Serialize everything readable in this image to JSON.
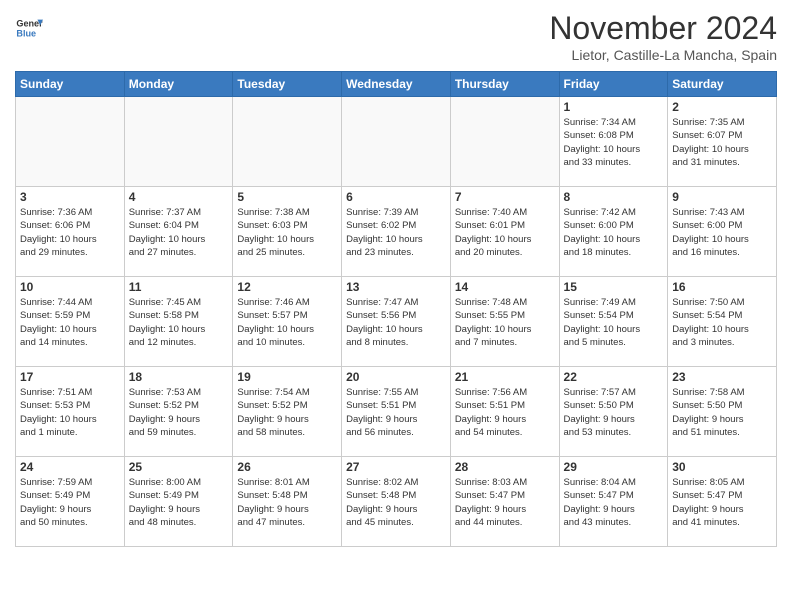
{
  "header": {
    "logo_line1": "General",
    "logo_line2": "Blue",
    "month": "November 2024",
    "location": "Lietor, Castille-La Mancha, Spain"
  },
  "weekdays": [
    "Sunday",
    "Monday",
    "Tuesday",
    "Wednesday",
    "Thursday",
    "Friday",
    "Saturday"
  ],
  "weeks": [
    [
      {
        "day": "",
        "detail": ""
      },
      {
        "day": "",
        "detail": ""
      },
      {
        "day": "",
        "detail": ""
      },
      {
        "day": "",
        "detail": ""
      },
      {
        "day": "",
        "detail": ""
      },
      {
        "day": "1",
        "detail": "Sunrise: 7:34 AM\nSunset: 6:08 PM\nDaylight: 10 hours\nand 33 minutes."
      },
      {
        "day": "2",
        "detail": "Sunrise: 7:35 AM\nSunset: 6:07 PM\nDaylight: 10 hours\nand 31 minutes."
      }
    ],
    [
      {
        "day": "3",
        "detail": "Sunrise: 7:36 AM\nSunset: 6:06 PM\nDaylight: 10 hours\nand 29 minutes."
      },
      {
        "day": "4",
        "detail": "Sunrise: 7:37 AM\nSunset: 6:04 PM\nDaylight: 10 hours\nand 27 minutes."
      },
      {
        "day": "5",
        "detail": "Sunrise: 7:38 AM\nSunset: 6:03 PM\nDaylight: 10 hours\nand 25 minutes."
      },
      {
        "day": "6",
        "detail": "Sunrise: 7:39 AM\nSunset: 6:02 PM\nDaylight: 10 hours\nand 23 minutes."
      },
      {
        "day": "7",
        "detail": "Sunrise: 7:40 AM\nSunset: 6:01 PM\nDaylight: 10 hours\nand 20 minutes."
      },
      {
        "day": "8",
        "detail": "Sunrise: 7:42 AM\nSunset: 6:00 PM\nDaylight: 10 hours\nand 18 minutes."
      },
      {
        "day": "9",
        "detail": "Sunrise: 7:43 AM\nSunset: 6:00 PM\nDaylight: 10 hours\nand 16 minutes."
      }
    ],
    [
      {
        "day": "10",
        "detail": "Sunrise: 7:44 AM\nSunset: 5:59 PM\nDaylight: 10 hours\nand 14 minutes."
      },
      {
        "day": "11",
        "detail": "Sunrise: 7:45 AM\nSunset: 5:58 PM\nDaylight: 10 hours\nand 12 minutes."
      },
      {
        "day": "12",
        "detail": "Sunrise: 7:46 AM\nSunset: 5:57 PM\nDaylight: 10 hours\nand 10 minutes."
      },
      {
        "day": "13",
        "detail": "Sunrise: 7:47 AM\nSunset: 5:56 PM\nDaylight: 10 hours\nand 8 minutes."
      },
      {
        "day": "14",
        "detail": "Sunrise: 7:48 AM\nSunset: 5:55 PM\nDaylight: 10 hours\nand 7 minutes."
      },
      {
        "day": "15",
        "detail": "Sunrise: 7:49 AM\nSunset: 5:54 PM\nDaylight: 10 hours\nand 5 minutes."
      },
      {
        "day": "16",
        "detail": "Sunrise: 7:50 AM\nSunset: 5:54 PM\nDaylight: 10 hours\nand 3 minutes."
      }
    ],
    [
      {
        "day": "17",
        "detail": "Sunrise: 7:51 AM\nSunset: 5:53 PM\nDaylight: 10 hours\nand 1 minute."
      },
      {
        "day": "18",
        "detail": "Sunrise: 7:53 AM\nSunset: 5:52 PM\nDaylight: 9 hours\nand 59 minutes."
      },
      {
        "day": "19",
        "detail": "Sunrise: 7:54 AM\nSunset: 5:52 PM\nDaylight: 9 hours\nand 58 minutes."
      },
      {
        "day": "20",
        "detail": "Sunrise: 7:55 AM\nSunset: 5:51 PM\nDaylight: 9 hours\nand 56 minutes."
      },
      {
        "day": "21",
        "detail": "Sunrise: 7:56 AM\nSunset: 5:51 PM\nDaylight: 9 hours\nand 54 minutes."
      },
      {
        "day": "22",
        "detail": "Sunrise: 7:57 AM\nSunset: 5:50 PM\nDaylight: 9 hours\nand 53 minutes."
      },
      {
        "day": "23",
        "detail": "Sunrise: 7:58 AM\nSunset: 5:50 PM\nDaylight: 9 hours\nand 51 minutes."
      }
    ],
    [
      {
        "day": "24",
        "detail": "Sunrise: 7:59 AM\nSunset: 5:49 PM\nDaylight: 9 hours\nand 50 minutes."
      },
      {
        "day": "25",
        "detail": "Sunrise: 8:00 AM\nSunset: 5:49 PM\nDaylight: 9 hours\nand 48 minutes."
      },
      {
        "day": "26",
        "detail": "Sunrise: 8:01 AM\nSunset: 5:48 PM\nDaylight: 9 hours\nand 47 minutes."
      },
      {
        "day": "27",
        "detail": "Sunrise: 8:02 AM\nSunset: 5:48 PM\nDaylight: 9 hours\nand 45 minutes."
      },
      {
        "day": "28",
        "detail": "Sunrise: 8:03 AM\nSunset: 5:47 PM\nDaylight: 9 hours\nand 44 minutes."
      },
      {
        "day": "29",
        "detail": "Sunrise: 8:04 AM\nSunset: 5:47 PM\nDaylight: 9 hours\nand 43 minutes."
      },
      {
        "day": "30",
        "detail": "Sunrise: 8:05 AM\nSunset: 5:47 PM\nDaylight: 9 hours\nand 41 minutes."
      }
    ]
  ]
}
